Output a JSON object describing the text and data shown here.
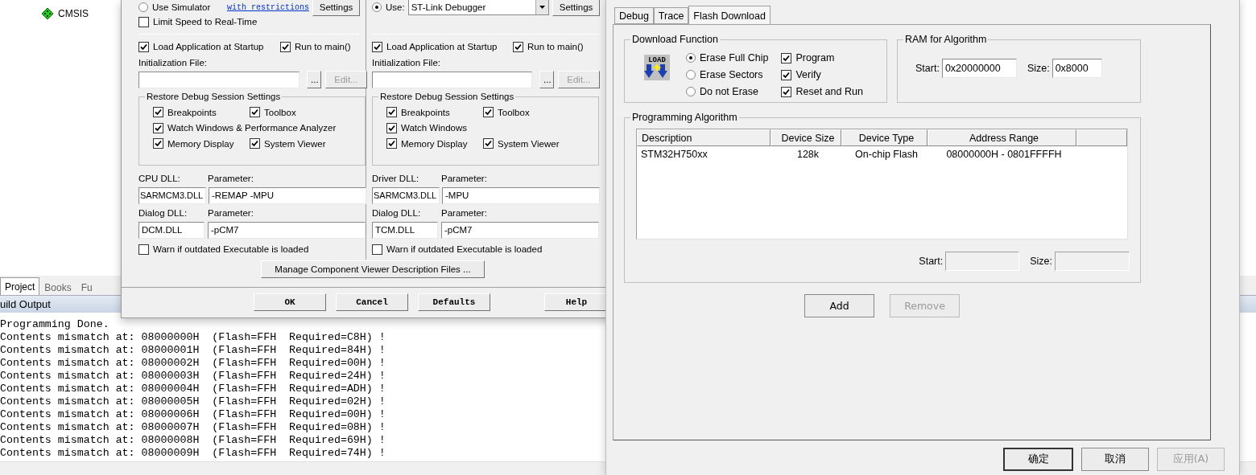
{
  "ide": {
    "tree": [
      {
        "label": "CMSIS"
      }
    ],
    "panel_tabs": [
      {
        "label": "Project",
        "selected": true
      },
      {
        "label": "Books",
        "selected": false
      },
      {
        "label": "Fu",
        "selected": false
      }
    ],
    "output_title": "uild Output",
    "output_lines": [
      "Programming Done.",
      "Contents mismatch at: 08000000H  (Flash=FFH  Required=C8H) !",
      "Contents mismatch at: 08000001H  (Flash=FFH  Required=84H) !",
      "Contents mismatch at: 08000002H  (Flash=FFH  Required=00H) !",
      "Contents mismatch at: 08000003H  (Flash=FFH  Required=24H) !",
      "Contents mismatch at: 08000004H  (Flash=FFH  Required=ADH) !",
      "Contents mismatch at: 08000005H  (Flash=FFH  Required=02H) !",
      "Contents mismatch at: 08000006H  (Flash=FFH  Required=00H) !",
      "Contents mismatch at: 08000007H  (Flash=FFH  Required=08H) !",
      "Contents mismatch at: 08000008H  (Flash=FFH  Required=69H) !",
      "Contents mismatch at: 08000009H  (Flash=FFH  Required=74H) !"
    ]
  },
  "target_dialog": {
    "columns": [
      {
        "kind": "simulator",
        "mode": {
          "label": "Use Simulator",
          "selected": false
        },
        "link": "with restrictions",
        "settings": "Settings",
        "limit_speed": {
          "label": "Limit Speed to Real-Time",
          "checked": false
        },
        "load_app": {
          "label": "Load Application at Startup",
          "checked": true
        },
        "run_to_main": {
          "label": "Run to main()",
          "checked": true
        },
        "init_file_label": "Initialization File:",
        "browse": "...",
        "edit": {
          "label": "Edit...",
          "disabled": true
        },
        "restore": {
          "title": "Restore Debug Session Settings",
          "rows": [
            {
              "options": [
                {
                  "label": "Breakpoints",
                  "checked": true
                },
                {
                  "label": "Toolbox",
                  "checked": true
                }
              ]
            },
            {
              "options": [
                {
                  "label": "Watch Windows & Performance Analyzer",
                  "checked": true
                }
              ]
            },
            {
              "options": [
                {
                  "label": "Memory Display",
                  "checked": true
                },
                {
                  "label": "System Viewer",
                  "checked": true
                }
              ]
            }
          ]
        },
        "dll_label": "CPU DLL:",
        "dll_param_label": "Parameter:",
        "dll_value": "SARMCM3.DLL",
        "dll_param": "-REMAP -MPU",
        "dialog_label": "Dialog DLL:",
        "dialog_param_label": "Parameter:",
        "dialog_value": "DCM.DLL",
        "dialog_param": "-pCM7",
        "warn": {
          "label": "Warn if outdated Executable is loaded",
          "checked": false
        }
      },
      {
        "kind": "target",
        "mode": {
          "label": "Use:",
          "selected": true
        },
        "debugger": "ST-Link Debugger",
        "settings": "Settings",
        "load_app": {
          "label": "Load Application at Startup",
          "checked": true
        },
        "run_to_main": {
          "label": "Run to main()",
          "checked": true
        },
        "init_file_label": "Initialization File:",
        "browse": "...",
        "edit": {
          "label": "Edit...",
          "disabled": true
        },
        "restore": {
          "title": "Restore Debug Session Settings",
          "rows": [
            {
              "options": [
                {
                  "label": "Breakpoints",
                  "checked": true
                },
                {
                  "label": "Toolbox",
                  "checked": true
                }
              ]
            },
            {
              "options": [
                {
                  "label": "Watch Windows",
                  "checked": true
                }
              ]
            },
            {
              "options": [
                {
                  "label": "Memory Display",
                  "checked": true
                },
                {
                  "label": "System Viewer",
                  "checked": true
                }
              ]
            }
          ]
        },
        "dll_label": "Driver DLL:",
        "dll_param_label": "Parameter:",
        "dll_value": "SARMCM3.DLL",
        "dll_param": "-MPU",
        "dialog_label": "Dialog DLL:",
        "dialog_param_label": "Parameter:",
        "dialog_value": "TCM.DLL",
        "dialog_param": "-pCM7",
        "warn": {
          "label": "Warn if outdated Executable is loaded",
          "checked": false
        }
      }
    ],
    "manage": "Manage Component Viewer Description Files ...",
    "buttons": [
      "OK",
      "Cancel",
      "Defaults",
      "Help"
    ]
  },
  "flash_dialog": {
    "tabs": [
      {
        "label": "Debug",
        "selected": false
      },
      {
        "label": "Trace",
        "selected": false
      },
      {
        "label": "Flash Download",
        "selected": true
      }
    ],
    "download_function": {
      "title": "Download Function",
      "icon_text": "LOAD",
      "erase": [
        {
          "label": "Erase Full Chip",
          "selected": true
        },
        {
          "label": "Erase Sectors",
          "selected": false
        },
        {
          "label": "Do not Erase",
          "selected": false
        }
      ],
      "checks": [
        {
          "label": "Program",
          "checked": true
        },
        {
          "label": "Verify",
          "checked": true
        },
        {
          "label": "Reset and Run",
          "checked": true
        }
      ]
    },
    "ram": {
      "title": "RAM for Algorithm",
      "start_label": "Start:",
      "start": "0x20000000",
      "size_label": "Size:",
      "size": "0x8000"
    },
    "algorithm": {
      "title": "Programming Algorithm",
      "columns": [
        "Description",
        "Device Size",
        "Device Type",
        "Address Range"
      ],
      "rows": [
        [
          "STM32H750xx",
          "128k",
          "On-chip Flash",
          "08000000H - 0801FFFFH"
        ]
      ],
      "start_label": "Start:",
      "size_label": "Size:"
    },
    "add": {
      "label": "Add",
      "disabled": false
    },
    "remove": {
      "label": "Remove",
      "disabled": true
    },
    "buttons": [
      {
        "label": "确定",
        "disabled": false
      },
      {
        "label": "取消",
        "disabled": false
      },
      {
        "label": "应用(A)",
        "disabled": true
      }
    ]
  }
}
